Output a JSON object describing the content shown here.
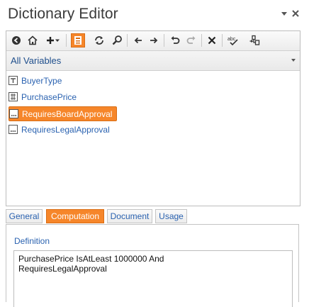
{
  "window": {
    "title": "Dictionary Editor"
  },
  "toolbar": {
    "icons": [
      "back-circle-icon",
      "home-icon",
      "add-icon",
      "dropdown-icon",
      "list-view-icon",
      "refresh-icon",
      "find-icon",
      "arrow-left-icon",
      "arrow-right-icon",
      "undo-icon",
      "redo-icon",
      "delete-icon",
      "spellcheck-icon",
      "assign-icon"
    ],
    "active_icon": "list-view-icon",
    "accent_color": "#f6862a"
  },
  "filter": {
    "selected": "All Variables"
  },
  "variables": [
    {
      "label": "BuyerType",
      "icon": "list-type-icon",
      "selected": false
    },
    {
      "label": "PurchasePrice",
      "icon": "currency-icon",
      "selected": false
    },
    {
      "label": "RequiresBoardApproval",
      "icon": "boolean-icon",
      "selected": true
    },
    {
      "label": "RequiresLegalApproval",
      "icon": "boolean-icon",
      "selected": false
    }
  ],
  "tabs": [
    {
      "label": "General",
      "active": false
    },
    {
      "label": "Computation",
      "active": true
    },
    {
      "label": "Document",
      "active": false
    },
    {
      "label": "Usage",
      "active": false
    }
  ],
  "computation": {
    "definition_label": "Definition",
    "definition_text": "PurchasePrice IsAtLeast 1000000 And\nRequiresLegalApproval"
  }
}
